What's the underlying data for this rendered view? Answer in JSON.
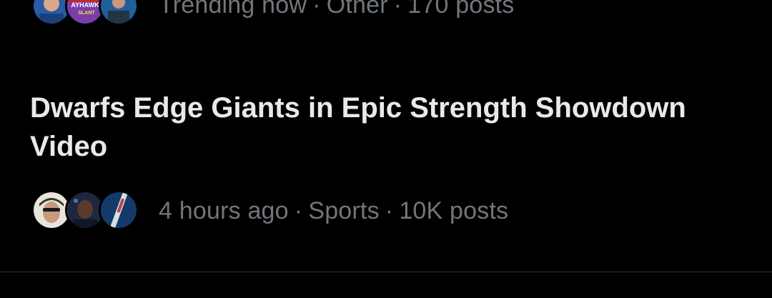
{
  "previous_trend": {
    "status": "Trending now",
    "category": "Other",
    "count": "170 posts",
    "avatar_badge": [
      "AYHAWK",
      "SLANT"
    ]
  },
  "trend": {
    "headline": "Dwarfs Edge Giants in Epic Strength Showdown Video",
    "time": "4 hours ago",
    "category": "Sports",
    "count": "10K posts"
  },
  "separator": "·",
  "colors": {
    "background": "#000000",
    "headline": "#e7e9ea",
    "meta": "#71767b",
    "divider": "#2f3336"
  }
}
